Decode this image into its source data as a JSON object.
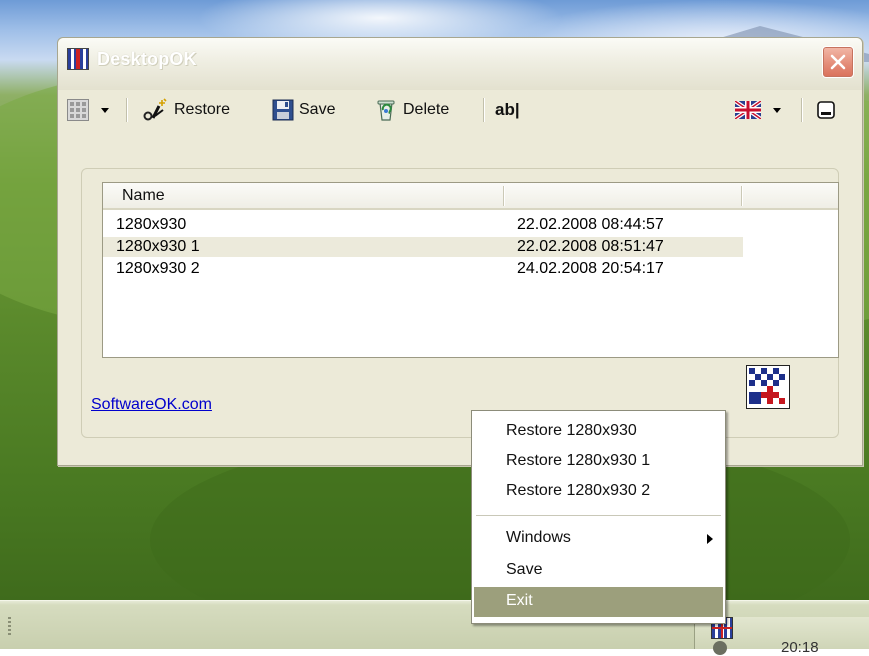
{
  "window": {
    "title": "DesktopOK"
  },
  "toolbar": {
    "restore_label": "Restore",
    "save_label": "Save",
    "delete_label": "Delete",
    "rename_label": "ab|"
  },
  "list": {
    "columns": [
      "Name",
      ""
    ],
    "rows": [
      {
        "name": "1280x930",
        "date": "22.02.2008 08:44:57",
        "selected": false
      },
      {
        "name": "1280x930 1",
        "date": "22.02.2008 08:51:47",
        "selected": true
      },
      {
        "name": "1280x930 2",
        "date": "24.02.2008 20:54:17",
        "selected": false
      }
    ]
  },
  "footer": {
    "link": "SoftwareOK.com"
  },
  "context_menu": {
    "items": [
      {
        "label": "Restore 1280x930"
      },
      {
        "label": "Restore 1280x930 1"
      },
      {
        "label": "Restore 1280x930 2"
      },
      {
        "label": "Windows",
        "submenu": true
      },
      {
        "label": "Save"
      },
      {
        "label": "Exit",
        "highlighted": true
      }
    ]
  },
  "taskbar": {
    "clock": "20:18"
  },
  "colors": {
    "menu_highlight": "#9c9f7c",
    "link": "#0000cc",
    "window_bg": "#ecead8",
    "selected_row": "#eceadb"
  },
  "icons": [
    "desktopok-app-icon",
    "layout-grid-icon",
    "restore-wand-icon",
    "floppy-save-icon",
    "recycle-delete-icon",
    "uk-flag-icon",
    "minimize-to-tray-icon",
    "close-icon",
    "desktopok-logo",
    "submenu-arrow-icon"
  ]
}
